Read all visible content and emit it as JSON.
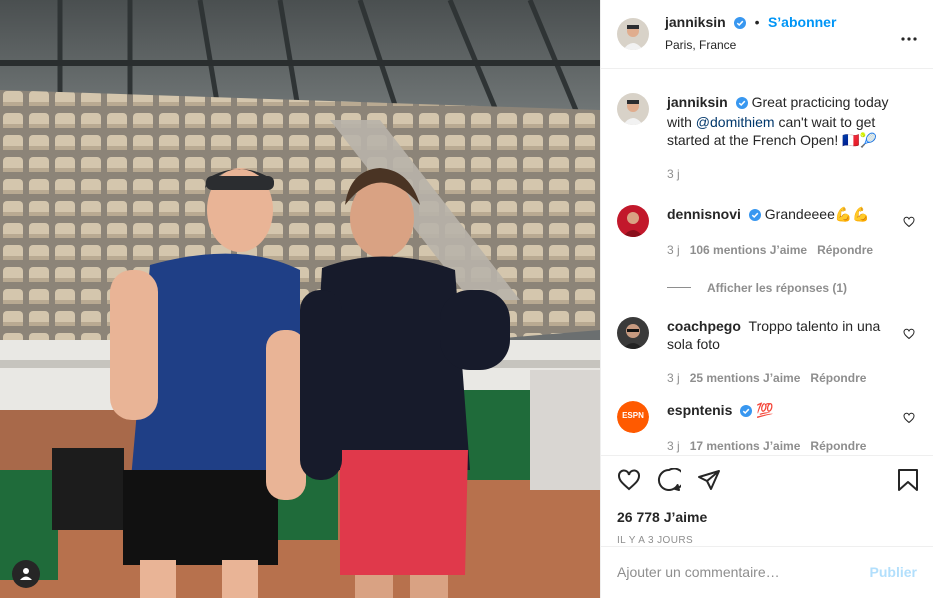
{
  "post": {
    "author": "janniksin",
    "follow_label": "S’abonner",
    "location": "Paris, France",
    "caption_pre": "Great practicing today with ",
    "caption_mention": "@domithiem",
    "caption_post": " can't wait to get started at the French Open! 🇫🇷🎾",
    "caption_time": "3 j"
  },
  "comments": [
    {
      "user": "dennisnovi",
      "verified": true,
      "text": "Grandeeee💪💪",
      "time": "3 j",
      "likes": "106 mentions J’aime",
      "reply": "Répondre",
      "replies_label": "Afficher les réponses (1)"
    },
    {
      "user": "coachpego",
      "verified": false,
      "text": "Troppo talento in una sola foto",
      "time": "3 j",
      "likes": "25 mentions J’aime",
      "reply": "Répondre"
    },
    {
      "user": "espntenis",
      "verified": true,
      "text": "💯",
      "time": "3 j",
      "likes": "17 mentions J’aime",
      "reply": "Répondre",
      "avatar_text": "ESPN"
    }
  ],
  "engagement": {
    "likes": "26 778 J’aime",
    "posted": "IL Y A 3 JOURS"
  },
  "composer": {
    "placeholder": "Ajouter un commentaire…",
    "publish_label": "Publier"
  },
  "colors": {
    "accent": "#0095f6",
    "verified": "#3897f0",
    "publish_disabled": "#b2dffc"
  }
}
